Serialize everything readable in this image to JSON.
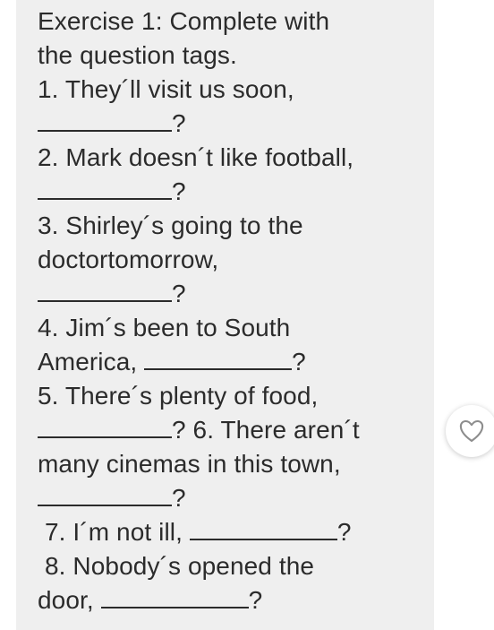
{
  "exercise": {
    "title_line_1": "Exercise 1: Complete with",
    "title_line_2": "the question tags.",
    "q1_a": "1. They´ll visit us soon,",
    "q1_end": "?",
    "q2_a": "2. Mark doesn´t like football,",
    "q2_end": "?",
    "q3_a": "3. Shirley´s going to the",
    "q3_b": "doctortomorrow,",
    "q3_end": "?",
    "q4_a": "4. Jim´s been to South",
    "q4_b": "America,",
    "q4_end": "?",
    "q5_a": "5. There´s plenty of food,",
    "q5_end": "? 6. There aren´t",
    "q6_b": "many cinemas in this town,",
    "q6_end": "?",
    "q7_a": "7. I´m not ill,",
    "q7_end": "?",
    "q8_a": "8. Nobody´s opened the",
    "q8_b": "door,",
    "q8_end": "?"
  },
  "icons": {
    "like": "heart-icon"
  },
  "colors": {
    "card_background": "#efefef",
    "text": "#2b2b2b",
    "page_background": "#ffffff"
  }
}
